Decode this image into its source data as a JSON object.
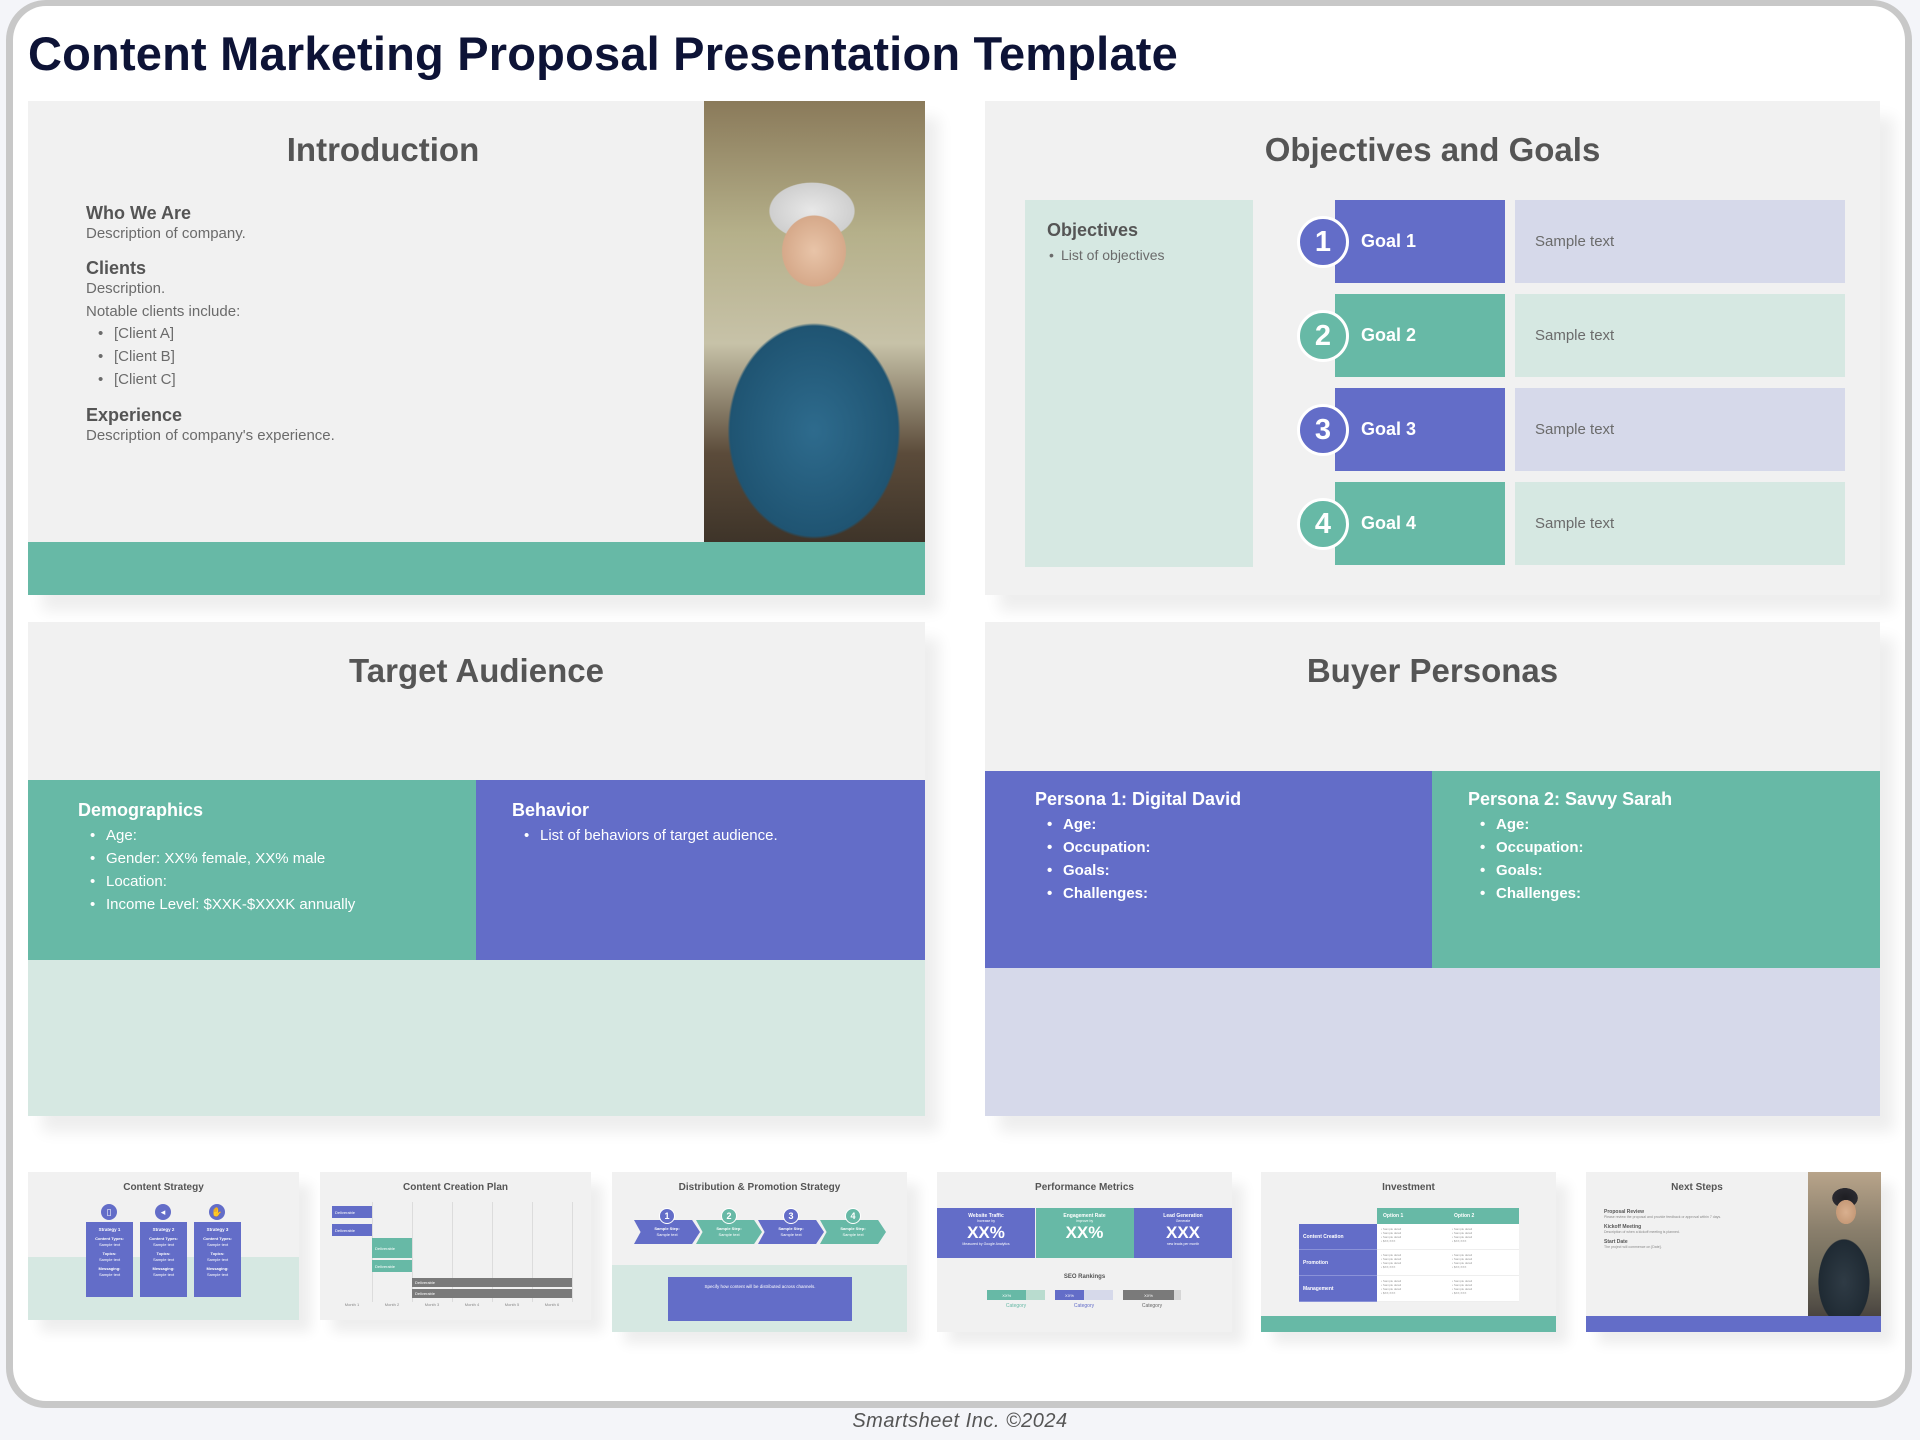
{
  "page_title": "Content Marketing Proposal Presentation Template",
  "colors": {
    "navy": "#0d1336",
    "teal": "#67b9a6",
    "purple": "#636dc8",
    "light_teal": "#d6e8e2",
    "light_purple": "#d6d9ea",
    "slide_bg": "#f1f1f1",
    "heading_gray": "#555555"
  },
  "introduction": {
    "title": "Introduction",
    "who_we_are": {
      "heading": "Who We Are",
      "text": "Description of company."
    },
    "clients": {
      "heading": "Clients",
      "text": "Description.",
      "notable": "Notable clients include:",
      "list": [
        "[Client A]",
        "[Client B]",
        "[Client C]"
      ]
    },
    "experience": {
      "heading": "Experience",
      "text": "Description of company's experience."
    },
    "photo": "woman-with-laptop-photo"
  },
  "objectives": {
    "title": "Objectives and Goals",
    "box_heading": "Objectives",
    "box_items": [
      "List of objectives"
    ],
    "goals": [
      {
        "num": "1",
        "label": "Goal 1",
        "text": "Sample text",
        "color": "#636dc8",
        "light": "#d6d9ea"
      },
      {
        "num": "2",
        "label": "Goal 2",
        "text": "Sample text",
        "color": "#67b9a6",
        "light": "#d6e8e2"
      },
      {
        "num": "3",
        "label": "Goal 3",
        "text": "Sample text",
        "color": "#636dc8",
        "light": "#d6d9ea"
      },
      {
        "num": "4",
        "label": "Goal 4",
        "text": "Sample text",
        "color": "#67b9a6",
        "light": "#d6e8e2"
      }
    ]
  },
  "target_audience": {
    "title": "Target Audience",
    "demographics": {
      "heading": "Demographics",
      "items": [
        "Age:",
        "Gender: XX% female, XX% male",
        "Location:",
        "Income Level: $XXK-$XXXK annually"
      ]
    },
    "behavior": {
      "heading": "Behavior",
      "items": [
        "List of behaviors of target audience."
      ]
    }
  },
  "buyer_personas": {
    "title": "Buyer Personas",
    "personas": [
      {
        "heading": "Persona 1: Digital David",
        "items": [
          "Age:",
          "Occupation:",
          "Goals:",
          "Challenges:"
        ]
      },
      {
        "heading": "Persona 2: Savvy Sarah",
        "items": [
          "Age:",
          "Occupation:",
          "Goals:",
          "Challenges:"
        ]
      }
    ]
  },
  "thumbnails": {
    "content_strategy": {
      "title": "Content Strategy",
      "cards": [
        {
          "icon": "phone-icon",
          "glyph": "▯",
          "heading": "Strategy 1",
          "lines": [
            "Content Types:",
            "Sample text",
            "Topics:",
            "Sample text",
            "Messaging:",
            "Sample text"
          ]
        },
        {
          "icon": "megaphone-icon",
          "glyph": "◂",
          "heading": "Strategy 2",
          "lines": [
            "Content Types:",
            "Sample text",
            "Topics:",
            "Sample text",
            "Messaging:",
            "Sample text"
          ]
        },
        {
          "icon": "handshake-icon",
          "glyph": "✋",
          "heading": "Strategy 3",
          "lines": [
            "Content Types:",
            "Sample text",
            "Topics:",
            "Sample text",
            "Messaging:",
            "Sample text"
          ]
        }
      ]
    },
    "content_creation": {
      "title": "Content Creation Plan",
      "bar_label": "Deliverable",
      "months": [
        "Month 1",
        "Month 2",
        "Month 3",
        "Month 4",
        "Month 5",
        "Month 6"
      ]
    },
    "distribution": {
      "title": "Distribution & Promotion Strategy",
      "steps": [
        {
          "num": "1",
          "label": "Sample Step:",
          "text": "Sample text"
        },
        {
          "num": "2",
          "label": "Sample Step:",
          "text": "Sample text"
        },
        {
          "num": "3",
          "label": "Sample Step:",
          "text": "Sample text"
        },
        {
          "num": "4",
          "label": "Sample Step:",
          "text": "Sample text"
        }
      ],
      "box_text": "Specify how content will be distributed across channels."
    },
    "performance": {
      "title": "Performance Metrics",
      "metrics": [
        {
          "heading": "Website Traffic",
          "sub": "Increase by",
          "value": "XX%",
          "note": "Measured by Google Analytics"
        },
        {
          "heading": "Engagement Rate",
          "sub": "Improve by",
          "value": "XX%",
          "note": ""
        },
        {
          "heading": "Lead Generation",
          "sub": "Generate",
          "value": "XXX",
          "note": "new leads per month"
        }
      ],
      "seo_title": "SEO Rankings",
      "seo": [
        {
          "value": "XX%",
          "category": "Category",
          "fill_fraction": 0.68
        },
        {
          "value": "XX%",
          "category": "Category",
          "fill_fraction": 0.5
        },
        {
          "value": "XX%",
          "category": "Category",
          "fill_fraction": 0.88
        }
      ]
    },
    "investment": {
      "title": "Investment",
      "columns": [
        "Option 1",
        "Option 2"
      ],
      "rows": [
        "Content Creation",
        "Promotion",
        "Management"
      ],
      "cell_lines": [
        "Sample detail",
        "Sample detail",
        "Sample detail",
        "$XX,XXX"
      ]
    },
    "next_steps": {
      "title": "Next Steps",
      "items": [
        {
          "heading": "Proposal Review",
          "text": "Please review the proposal and provide feedback or approval within 7 days."
        },
        {
          "heading": "Kickoff Meeting",
          "text": "Description of when a kickoff meeting is planned."
        },
        {
          "heading": "Start Date",
          "text": "The project will commence on [Date]."
        }
      ],
      "photo": "man-with-phone-photo"
    }
  },
  "footer": "Smartsheet Inc. ©2024"
}
